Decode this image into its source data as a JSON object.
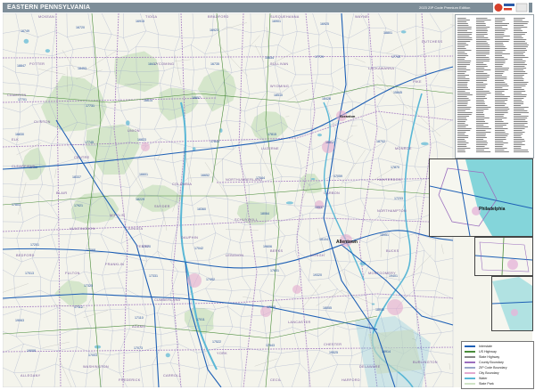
{
  "header": {
    "title": "EASTERN PENNSYLVANIA",
    "edition": "2023 ZIP Code Premium Edition"
  },
  "colors": {
    "header_bar": "#7e8e99",
    "map_bg": "#f4f4ec",
    "water": "#5ab7d6",
    "state_forest": "#cfe3c6",
    "interstate": "#1d5fb5",
    "us_highway": "#4a8c3a",
    "county_border": "#9b6fbe",
    "zip_border": "#9aa6c8",
    "inset_water": "#27c6cf"
  },
  "cities": {
    "philadelphia": "Philadelphia",
    "allentown": "Allentown",
    "scranton": "Scranton"
  },
  "counties": [
    {
      "id": "mckean",
      "name": "MCKEAN"
    },
    {
      "id": "potter",
      "name": "POTTER"
    },
    {
      "id": "tioga",
      "name": "TIOGA"
    },
    {
      "id": "bradford",
      "name": "BRADFORD"
    },
    {
      "id": "susquehanna",
      "name": "SUSQUEHANNA"
    },
    {
      "id": "wayne",
      "name": "WAYNE"
    },
    {
      "id": "cameron",
      "name": "CAMERON"
    },
    {
      "id": "clinton",
      "name": "CLINTON"
    },
    {
      "id": "lycoming",
      "name": "LYCOMING"
    },
    {
      "id": "sullivan",
      "name": "SULLIVAN"
    },
    {
      "id": "wyoming",
      "name": "WYOMING"
    },
    {
      "id": "lackawanna",
      "name": "LACKAWANNA"
    },
    {
      "id": "pike",
      "name": "PIKE"
    },
    {
      "id": "elk",
      "name": "ELK"
    },
    {
      "id": "clearfield",
      "name": "CLEARFIELD"
    },
    {
      "id": "centre",
      "name": "CENTRE"
    },
    {
      "id": "union",
      "name": "UNION"
    },
    {
      "id": "columbia",
      "name": "COLUMBIA"
    },
    {
      "id": "luzerne",
      "name": "LUZERNE"
    },
    {
      "id": "monroe",
      "name": "MONROE"
    },
    {
      "id": "blair",
      "name": "BLAIR"
    },
    {
      "id": "huntingdon",
      "name": "HUNTINGDON"
    },
    {
      "id": "mifflin",
      "name": "MIFFLIN"
    },
    {
      "id": "juniata",
      "name": "JUNIATA"
    },
    {
      "id": "snyder",
      "name": "SNYDER"
    },
    {
      "id": "northumberland",
      "name": "NORTHUMBERLAND"
    },
    {
      "id": "schuylkill",
      "name": "SCHUYLKILL"
    },
    {
      "id": "carbon",
      "name": "CARBON"
    },
    {
      "id": "northampton",
      "name": "NORTHAMPTON"
    },
    {
      "id": "bedford",
      "name": "BEDFORD"
    },
    {
      "id": "fulton",
      "name": "FULTON"
    },
    {
      "id": "franklin",
      "name": "FRANKLIN"
    },
    {
      "id": "perry",
      "name": "PERRY"
    },
    {
      "id": "dauphin",
      "name": "DAUPHIN"
    },
    {
      "id": "lebanon",
      "name": "LEBANON"
    },
    {
      "id": "berks",
      "name": "BERKS"
    },
    {
      "id": "lehigh",
      "name": "LEHIGH"
    },
    {
      "id": "bucks",
      "name": "BUCKS"
    },
    {
      "id": "cumberland",
      "name": "CUMBERLAND"
    },
    {
      "id": "adams",
      "name": "ADAMS"
    },
    {
      "id": "york",
      "name": "YORK"
    },
    {
      "id": "lancaster",
      "name": "LANCASTER"
    },
    {
      "id": "chester",
      "name": "CHESTER"
    },
    {
      "id": "montgomery",
      "name": "MONTGOMERY"
    },
    {
      "id": "hunterdon",
      "name": "HUNTERDON"
    },
    {
      "id": "burlington",
      "name": "BURLINGTON"
    },
    {
      "id": "cecil",
      "name": "CECIL"
    },
    {
      "id": "harford",
      "name": "HARFORD"
    },
    {
      "id": "carroll",
      "name": "CARROLL"
    },
    {
      "id": "washington",
      "name": "WASHINGTON"
    },
    {
      "id": "frederick",
      "name": "FREDERICK"
    },
    {
      "id": "allegany",
      "name": "ALLEGANY"
    },
    {
      "id": "delaware",
      "name": "DELAWARE"
    },
    {
      "id": "dutchess",
      "name": "DUTCHESS"
    }
  ],
  "zips": [
    "16749",
    "16720",
    "16915",
    "16923",
    "16901",
    "16925",
    "18801",
    "18847",
    "18453",
    "18417",
    "16735",
    "15834",
    "17729",
    "17740",
    "17701",
    "17731",
    "18614",
    "18657",
    "18510",
    "18428",
    "15845",
    "16830",
    "17745",
    "16823",
    "17844",
    "17815",
    "18612",
    "18702",
    "18466",
    "18337",
    "16601",
    "16652",
    "17044",
    "17059",
    "17870",
    "17801",
    "17921",
    "18229",
    "18360",
    "18064",
    "15537",
    "17233",
    "17201",
    "17068",
    "17020",
    "17042",
    "19606",
    "18104",
    "18951",
    "17013",
    "17325",
    "17331",
    "17402",
    "17601",
    "19320",
    "19401",
    "19063",
    "17112",
    "17110",
    "17011",
    "17055",
    "18055",
    "18940",
    "19008",
    "17003",
    "17073",
    "17522",
    "17543",
    "19525",
    "18914"
  ],
  "legend": {
    "items": [
      "Interstate",
      "US Highway",
      "State Highway",
      "County Boundary",
      "ZIP Code Boundary",
      "City Boundary",
      "Water",
      "State Park"
    ]
  }
}
